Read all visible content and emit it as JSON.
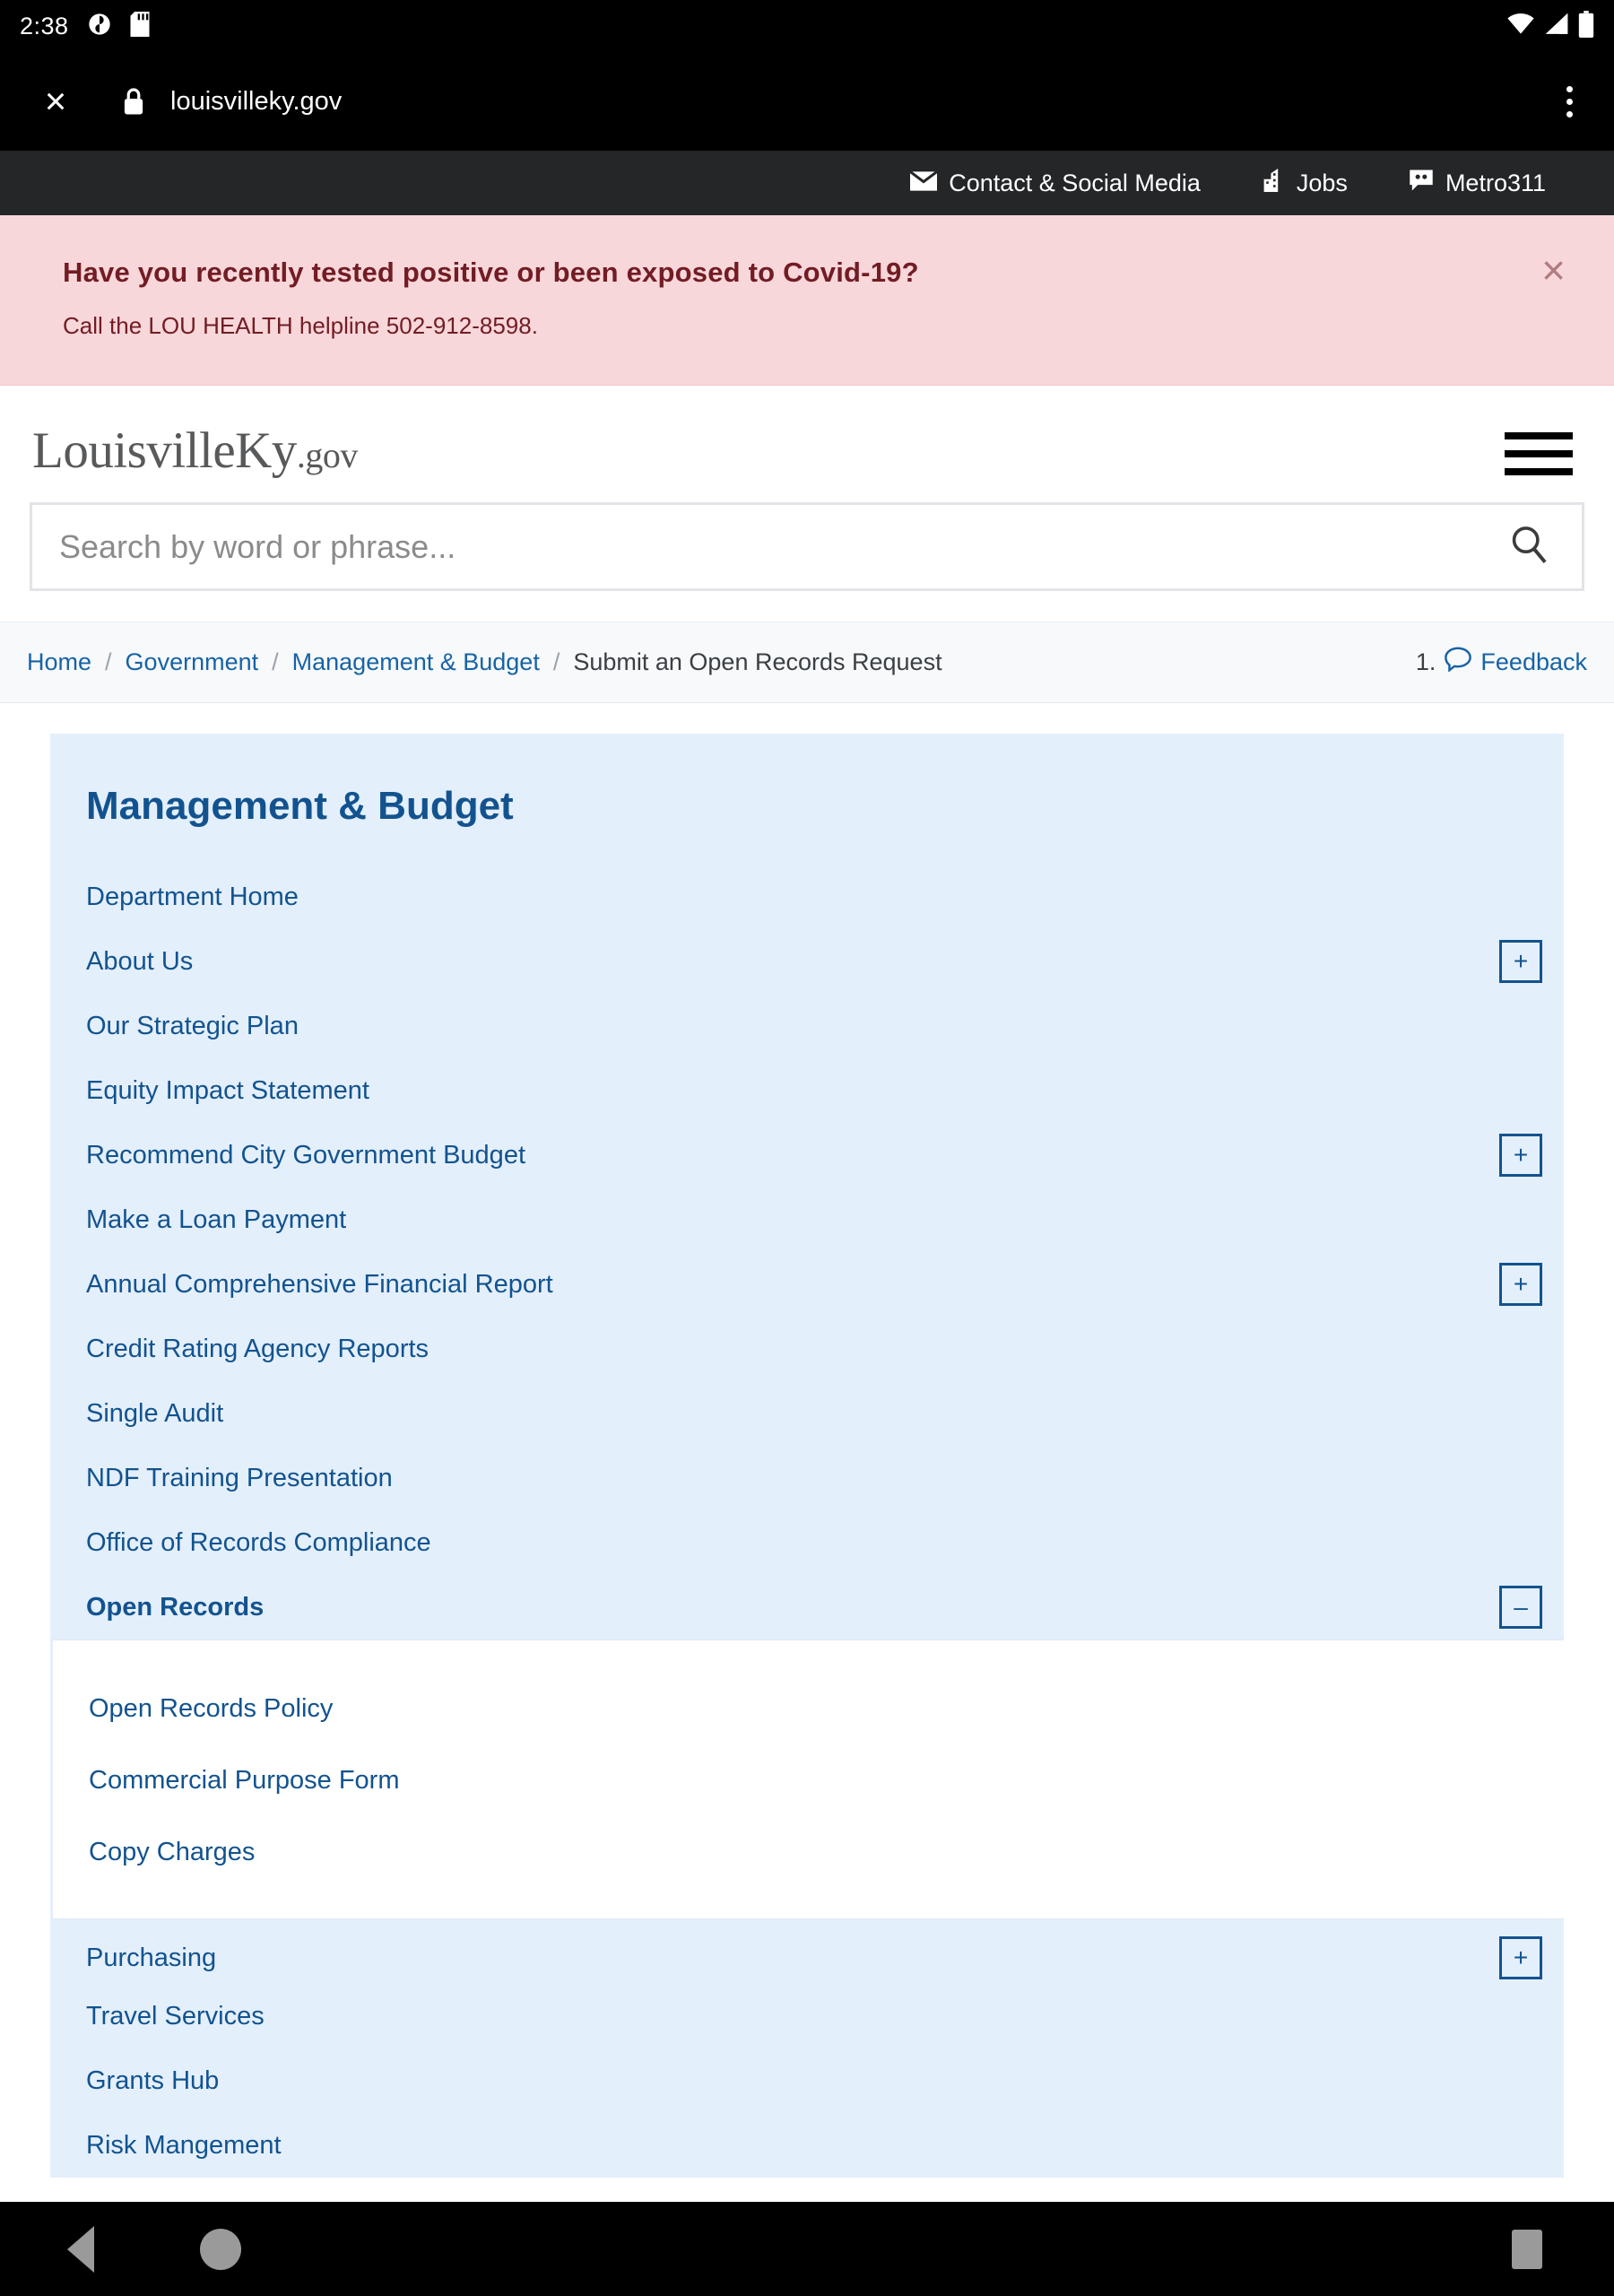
{
  "status_bar": {
    "time": "2:38",
    "left_icons": [
      "notification-circle-icon",
      "sd-card-icon"
    ],
    "right_icons": [
      "wifi-icon",
      "cell-signal-icon",
      "battery-icon"
    ]
  },
  "browser": {
    "close_label": "×",
    "lock_icon": "padlock-icon",
    "url": "louisvilleky.gov",
    "menu_icon": "kebab-menu-icon"
  },
  "utility_nav": {
    "items": [
      {
        "label": "Contact & Social Media",
        "icon": "envelope-icon"
      },
      {
        "label": "Jobs",
        "icon": "building-icon"
      },
      {
        "label": "Metro311",
        "icon": "chat-bubble-icon"
      }
    ]
  },
  "alert": {
    "title": "Have you recently tested positive or been exposed to Covid-19?",
    "subtitle": "Call the LOU HEALTH helpline 502-912-8598.",
    "close_label": "×",
    "bg_color": "#f8d7da",
    "text_color": "#721c24"
  },
  "header": {
    "logo_main": "LouisvilleKy",
    "logo_suffix": ".gov",
    "menu_icon": "hamburger-icon"
  },
  "search": {
    "placeholder": "Search by word or phrase...",
    "value": "",
    "icon": "search-icon"
  },
  "breadcrumb": {
    "items": [
      {
        "label": "Home",
        "link": true
      },
      {
        "label": "Government",
        "link": true
      },
      {
        "label": "Management & Budget",
        "link": true
      },
      {
        "label": "Submit an Open Records Request",
        "link": false
      }
    ],
    "separator": "/"
  },
  "feedback": {
    "number": "1.",
    "label": "Feedback",
    "icon": "speech-bubble-icon"
  },
  "side_panel": {
    "title": "Management & Budget",
    "bg_color": "#e4effc",
    "accent_color": "#12538f",
    "items": [
      {
        "label": "Department Home",
        "toggle": null,
        "active": false
      },
      {
        "label": "About Us",
        "toggle": "+",
        "active": false
      },
      {
        "label": "Our Strategic Plan",
        "toggle": null,
        "active": false
      },
      {
        "label": "Equity Impact Statement",
        "toggle": null,
        "active": false
      },
      {
        "label": "Recommend City Government Budget",
        "toggle": "+",
        "active": false
      },
      {
        "label": "Make a Loan Payment",
        "toggle": null,
        "active": false
      },
      {
        "label": "Annual Comprehensive Financial Report",
        "toggle": "+",
        "active": false
      },
      {
        "label": "Credit Rating Agency Reports",
        "toggle": null,
        "active": false
      },
      {
        "label": "Single Audit",
        "toggle": null,
        "active": false
      },
      {
        "label": "NDF Training Presentation",
        "toggle": null,
        "active": false
      },
      {
        "label": "Office of Records Compliance",
        "toggle": null,
        "active": false
      },
      {
        "label": "Open Records",
        "toggle": "–",
        "active": true
      }
    ],
    "submenu_items": [
      {
        "label": "Open Records Policy"
      },
      {
        "label": "Commercial Purpose Form"
      },
      {
        "label": "Copy Charges"
      }
    ],
    "items_after": [
      {
        "label": "Purchasing",
        "toggle": "+",
        "active": false
      },
      {
        "label": "Travel Services",
        "toggle": null,
        "active": false
      },
      {
        "label": "Grants Hub",
        "toggle": null,
        "active": false
      },
      {
        "label": "Risk Mangement",
        "toggle": null,
        "active": false
      }
    ]
  },
  "nav_bar": {
    "back_icon": "back-triangle-icon",
    "home_icon": "home-circle-icon",
    "recents_icon": "recents-square-icon"
  }
}
